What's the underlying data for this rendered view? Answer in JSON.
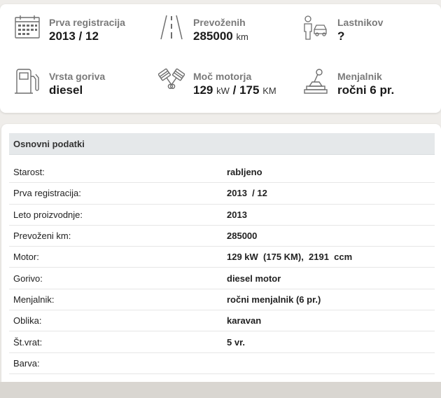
{
  "specs": [
    {
      "icon": "calendar-icon",
      "label": "Prva registracija",
      "value": "2013 / 12",
      "unit": ""
    },
    {
      "icon": "road-icon",
      "label": "Prevoženih",
      "value": "285000",
      "unit": "km"
    },
    {
      "icon": "owner-car-icon",
      "label": "Lastnikov",
      "value": "?",
      "unit": ""
    },
    {
      "icon": "fuel-pump-icon",
      "label": "Vrsta goriva",
      "value": "diesel",
      "unit": ""
    },
    {
      "icon": "engine-piston-icon",
      "label": "Moč motorja",
      "value_kw": "129",
      "unit_kw": "kW",
      "sep": "/",
      "value_km": "175",
      "unit_km": "KM"
    },
    {
      "icon": "gear-shift-icon",
      "label": "Menjalnik",
      "value": "ročni 6 pr.",
      "unit": ""
    }
  ],
  "section": {
    "title": "Osnovni podatki",
    "rows": [
      {
        "key": "Starost:",
        "value": "rabljeno"
      },
      {
        "key": "Prva registracija:",
        "value": "2013  / 12"
      },
      {
        "key": "Leto proizvodnje:",
        "value": "2013"
      },
      {
        "key": "Prevoženi km:",
        "value": "285000"
      },
      {
        "key": "Motor:",
        "value": "129 kW  (175 KM),  2191  ccm"
      },
      {
        "key": "Gorivo:",
        "value": "diesel motor"
      },
      {
        "key": "Menjalnik:",
        "value": "ročni menjalnik (6 pr.)"
      },
      {
        "key": "Oblika:",
        "value": "karavan"
      },
      {
        "key": "Št.vrat:",
        "value": "5 vr."
      },
      {
        "key": "Barva:",
        "value": ""
      }
    ]
  }
}
